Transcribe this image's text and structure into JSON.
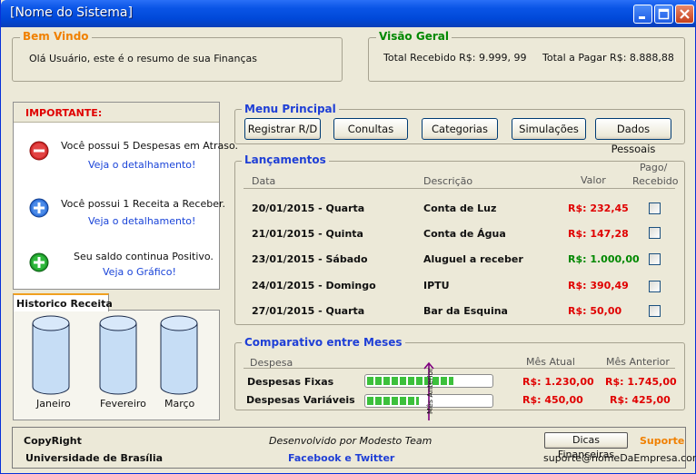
{
  "window": {
    "title": "[Nome do Sistema]"
  },
  "welcome": {
    "legend": "Bem Vindo",
    "message": "Olá Usuário, este é o resumo de sua Finanças"
  },
  "overview": {
    "legend": "Visão Geral",
    "received_label": "Total Recebido R$: 9.999, 99",
    "payable_label": "Total a Pagar R$: 8.888,88"
  },
  "important": {
    "title": "IMPORTANTE:",
    "items": [
      {
        "icon": "minus-circle-icon",
        "text": "Você possui 5 Despesas em Atraso.",
        "link": "Veja o detalhamento!"
      },
      {
        "icon": "plus-circle-icon",
        "text": "Você possui 1 Receita a Receber.",
        "link": "Veja o detalhamento!"
      },
      {
        "icon": "green-plus-circle-icon",
        "text": "Seu saldo continua Positivo.",
        "link": "Veja o Gráfico!"
      }
    ]
  },
  "history": {
    "tab": "Historico Receita",
    "months": [
      "Janeiro",
      "Fevereiro",
      "Março"
    ]
  },
  "menu": {
    "legend": "Menu Principal",
    "buttons": [
      "Registrar R/D",
      "Conultas",
      "Categorias",
      "Simulações",
      "Dados Pessoais"
    ]
  },
  "entries": {
    "legend": "Lançamentos",
    "headers": {
      "date": "Data",
      "description": "Descrição",
      "value": "Valor",
      "paid_line1": "Pago/",
      "paid_line2": "Recebido"
    },
    "rows": [
      {
        "date": "20/01/2015 - Quarta",
        "description": "Conta de Luz",
        "value": "R$: 232,45",
        "kind": "expense",
        "checked": false
      },
      {
        "date": "21/01/2015 - Quinta",
        "description": "Conta de Água",
        "value": "R$: 147,28",
        "kind": "expense",
        "checked": false
      },
      {
        "date": "23/01/2015 - Sábado",
        "description": "Aluguel a receber",
        "value": "R$: 1.000,00",
        "kind": "income",
        "checked": false
      },
      {
        "date": "24/01/2015 - Domingo",
        "description": "IPTU",
        "value": "R$: 390,49",
        "kind": "expense",
        "checked": false
      },
      {
        "date": "27/01/2015 - Quarta",
        "description": "Bar da Esquina",
        "value": "R$: 50,00",
        "kind": "expense",
        "checked": false
      }
    ]
  },
  "comparison": {
    "legend": "Comparativo entre Meses",
    "headers": {
      "expense": "Despesa",
      "current": "Mês Atual",
      "previous": "Mês Anterior"
    },
    "marker_label": "Mês Anterior",
    "rows": [
      {
        "label": "Despesas Fixas",
        "progress": 0.7,
        "current": "R$: 1.230,00",
        "previous": "R$: 1.745,00"
      },
      {
        "label": "Despesas Variáveis",
        "progress": 0.42,
        "current": "R$: 450,00",
        "previous": "R$: 425,00"
      }
    ]
  },
  "footer": {
    "copyright": "CopyRight",
    "university": "Universidade de Brasília",
    "developed": "Desenvolvido por Modesto Team",
    "social": "Facebook e Twitter",
    "tips_button": "Dicas Financeiras",
    "support": "Suporte",
    "email": "suporte@nomeDaEmpresa.com"
  },
  "colors": {
    "expense": "#e00000",
    "income": "#008800",
    "accent": "#1f3fd6",
    "legend_orange": "#f08000"
  }
}
